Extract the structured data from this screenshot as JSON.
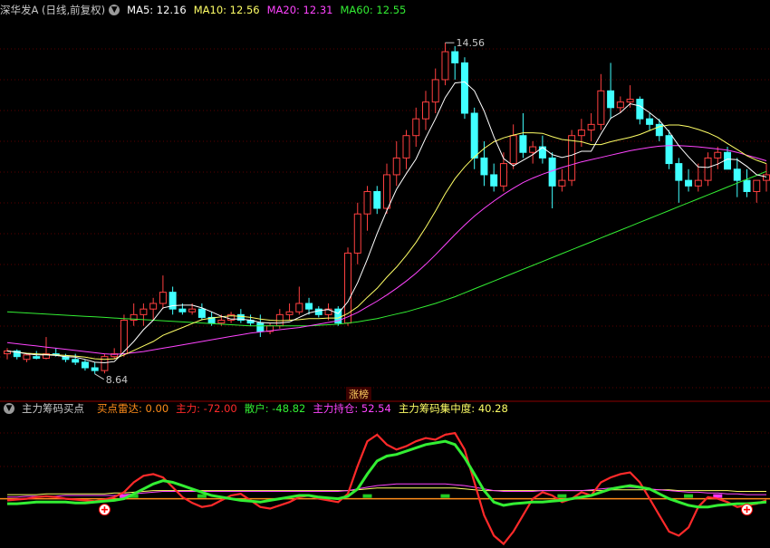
{
  "top": {
    "title": "深华发A (日线,前复权)",
    "ma": [
      {
        "label": "MA5: 12.16",
        "color": "#ffffff"
      },
      {
        "label": "MA10: 12.56",
        "color": "#ffff66"
      },
      {
        "label": "MA20: 12.31",
        "color": "#ff44ff"
      },
      {
        "label": "MA60: 12.55",
        "color": "#33ee33"
      }
    ],
    "high_label": "14.56",
    "low_label": "8.64",
    "limit_up_label": "涨榜"
  },
  "indicator": {
    "name": "主力筹码买点",
    "items": [
      {
        "label": "买点雷达: 0.00",
        "color": "#ff8c1a"
      },
      {
        "label": "主力: -72.00",
        "color": "#ff2a2a"
      },
      {
        "label": "散户: -48.82",
        "color": "#33ee33"
      },
      {
        "label": "主力持仓: 52.54",
        "color": "#ff44ff"
      },
      {
        "label": "主力筹码集中度: 40.28",
        "color": "#ffff66"
      }
    ]
  },
  "chart_data": {
    "type": "candlestick",
    "ylim": [
      8.2,
      15.0
    ],
    "colors": {
      "up": "#ff4040",
      "down": "#40ffff",
      "ma5": "#ffffff",
      "ma10": "#ffff66",
      "ma20": "#ff44ff",
      "ma60": "#33ee33"
    },
    "candles": [
      [
        9.0,
        9.1,
        8.9,
        9.05
      ],
      [
        9.05,
        9.08,
        8.9,
        8.95
      ],
      [
        8.9,
        9.0,
        8.85,
        8.98
      ],
      [
        8.95,
        9.05,
        8.9,
        8.92
      ],
      [
        8.92,
        9.3,
        8.9,
        9.0
      ],
      [
        9.0,
        9.1,
        8.95,
        8.98
      ],
      [
        8.95,
        9.0,
        8.85,
        8.9
      ],
      [
        8.9,
        9.0,
        8.8,
        8.85
      ],
      [
        8.85,
        8.9,
        8.7,
        8.75
      ],
      [
        8.75,
        8.85,
        8.64,
        8.7
      ],
      [
        8.7,
        9.0,
        8.65,
        8.95
      ],
      [
        8.95,
        9.1,
        8.9,
        9.0
      ],
      [
        9.0,
        9.7,
        8.95,
        9.6
      ],
      [
        9.6,
        9.9,
        9.5,
        9.7
      ],
      [
        9.7,
        9.9,
        9.5,
        9.8
      ],
      [
        9.8,
        10.0,
        9.6,
        9.9
      ],
      [
        9.9,
        10.4,
        9.8,
        10.1
      ],
      [
        10.1,
        10.2,
        9.7,
        9.8
      ],
      [
        9.8,
        9.9,
        9.7,
        9.75
      ],
      [
        9.75,
        9.9,
        9.7,
        9.8
      ],
      [
        9.8,
        9.9,
        9.6,
        9.65
      ],
      [
        9.65,
        9.75,
        9.5,
        9.55
      ],
      [
        9.55,
        9.7,
        9.5,
        9.6
      ],
      [
        9.6,
        9.75,
        9.55,
        9.7
      ],
      [
        9.7,
        9.8,
        9.55,
        9.6
      ],
      [
        9.6,
        9.7,
        9.5,
        9.55
      ],
      [
        9.55,
        9.7,
        9.3,
        9.4
      ],
      [
        9.4,
        9.55,
        9.35,
        9.5
      ],
      [
        9.5,
        9.8,
        9.45,
        9.7
      ],
      [
        9.7,
        9.9,
        9.6,
        9.75
      ],
      [
        9.75,
        10.2,
        9.7,
        9.9
      ],
      [
        9.9,
        10.0,
        9.7,
        9.8
      ],
      [
        9.8,
        9.85,
        9.65,
        9.7
      ],
      [
        9.7,
        9.9,
        9.6,
        9.8
      ],
      [
        9.8,
        9.85,
        9.5,
        9.55
      ],
      [
        9.55,
        10.9,
        9.5,
        10.8
      ],
      [
        10.8,
        11.7,
        10.6,
        11.5
      ],
      [
        11.5,
        12.0,
        11.2,
        11.9
      ],
      [
        11.9,
        12.0,
        11.5,
        11.6
      ],
      [
        11.6,
        12.4,
        11.5,
        12.2
      ],
      [
        12.2,
        12.8,
        12.0,
        12.5
      ],
      [
        12.5,
        13.0,
        12.3,
        12.9
      ],
      [
        12.9,
        13.4,
        12.7,
        13.2
      ],
      [
        13.2,
        13.7,
        13.0,
        13.5
      ],
      [
        13.5,
        14.1,
        13.3,
        13.9
      ],
      [
        13.9,
        14.56,
        13.8,
        14.4
      ],
      [
        14.4,
        14.5,
        13.9,
        14.2
      ],
      [
        14.2,
        14.3,
        13.2,
        13.3
      ],
      [
        13.3,
        13.4,
        12.3,
        12.5
      ],
      [
        12.5,
        12.8,
        12.0,
        12.2
      ],
      [
        12.2,
        12.4,
        11.9,
        12.0
      ],
      [
        12.0,
        12.6,
        11.9,
        12.4
      ],
      [
        12.4,
        13.1,
        12.3,
        12.9
      ],
      [
        12.9,
        13.3,
        12.5,
        12.6
      ],
      [
        12.6,
        12.8,
        12.4,
        12.7
      ],
      [
        12.7,
        12.9,
        12.4,
        12.5
      ],
      [
        12.5,
        12.6,
        11.6,
        12.0
      ],
      [
        12.0,
        12.3,
        11.9,
        12.1
      ],
      [
        12.1,
        13.0,
        12.0,
        12.9
      ],
      [
        12.9,
        13.2,
        12.7,
        13.0
      ],
      [
        13.0,
        13.3,
        12.8,
        13.1
      ],
      [
        13.1,
        14.0,
        13.0,
        13.7
      ],
      [
        13.7,
        14.2,
        13.2,
        13.4
      ],
      [
        13.4,
        13.6,
        13.3,
        13.5
      ],
      [
        13.5,
        13.8,
        13.4,
        13.55
      ],
      [
        13.55,
        13.6,
        13.1,
        13.2
      ],
      [
        13.2,
        13.3,
        13.0,
        13.1
      ],
      [
        13.1,
        13.2,
        12.8,
        12.9
      ],
      [
        12.9,
        13.0,
        12.3,
        12.4
      ],
      [
        12.4,
        12.5,
        11.7,
        12.1
      ],
      [
        12.1,
        12.3,
        11.9,
        12.0
      ],
      [
        12.0,
        12.4,
        11.9,
        12.1
      ],
      [
        12.1,
        12.6,
        12.0,
        12.5
      ],
      [
        12.5,
        12.7,
        12.3,
        12.6
      ],
      [
        12.6,
        12.7,
        12.3,
        12.3
      ],
      [
        12.3,
        12.5,
        11.8,
        12.1
      ],
      [
        12.1,
        12.3,
        11.8,
        11.9
      ],
      [
        11.9,
        12.1,
        11.7,
        12.1
      ],
      [
        12.1,
        12.4,
        11.9,
        12.2
      ]
    ],
    "ma5": [
      9.05,
      9.03,
      9.0,
      8.98,
      8.98,
      8.97,
      8.95,
      8.94,
      8.9,
      8.85,
      8.84,
      8.86,
      9.04,
      9.22,
      9.43,
      9.6,
      9.82,
      9.86,
      9.87,
      9.87,
      9.82,
      9.75,
      9.67,
      9.62,
      9.62,
      9.6,
      9.56,
      9.55,
      9.55,
      9.57,
      9.65,
      9.73,
      9.77,
      9.79,
      9.72,
      9.93,
      10.27,
      10.69,
      11.15,
      11.56,
      11.94,
      12.22,
      12.48,
      12.86,
      13.2,
      13.58,
      13.84,
      13.86,
      13.7,
      13.34,
      12.88,
      12.49,
      12.36,
      12.46,
      12.56,
      12.69,
      12.56,
      12.51,
      12.55,
      12.62,
      12.62,
      12.93,
      13.21,
      13.31,
      13.47,
      13.43,
      13.31,
      13.17,
      12.97,
      12.72,
      12.52,
      12.34,
      12.33,
      12.39,
      12.48,
      12.47,
      12.35,
      12.2,
      12.16
    ],
    "ma10": [
      9.05,
      9.03,
      9.01,
      9.0,
      8.99,
      8.98,
      8.97,
      8.96,
      8.94,
      8.91,
      8.9,
      8.91,
      8.98,
      9.06,
      9.14,
      9.22,
      9.33,
      9.4,
      9.47,
      9.54,
      9.61,
      9.64,
      9.66,
      9.68,
      9.67,
      9.65,
      9.62,
      9.6,
      9.59,
      9.6,
      9.61,
      9.63,
      9.63,
      9.64,
      9.64,
      9.72,
      9.84,
      10.01,
      10.17,
      10.37,
      10.55,
      10.76,
      10.99,
      11.26,
      11.55,
      11.86,
      12.13,
      12.34,
      12.52,
      12.67,
      12.79,
      12.86,
      12.91,
      12.95,
      12.95,
      12.94,
      12.88,
      12.83,
      12.81,
      12.79,
      12.74,
      12.74,
      12.79,
      12.83,
      12.87,
      12.92,
      12.99,
      13.06,
      13.09,
      13.09,
      13.06,
      13.01,
      12.95,
      12.87,
      12.76,
      12.65,
      12.54,
      12.46,
      12.4
    ],
    "ma20": [
      9.2,
      9.18,
      9.16,
      9.14,
      9.12,
      9.1,
      9.08,
      9.06,
      9.04,
      9.02,
      9.0,
      8.99,
      9.0,
      9.02,
      9.04,
      9.07,
      9.1,
      9.13,
      9.16,
      9.19,
      9.22,
      9.25,
      9.28,
      9.31,
      9.34,
      9.37,
      9.39,
      9.41,
      9.43,
      9.45,
      9.47,
      9.5,
      9.53,
      9.56,
      9.59,
      9.66,
      9.74,
      9.84,
      9.94,
      10.05,
      10.17,
      10.3,
      10.44,
      10.6,
      10.77,
      10.95,
      11.13,
      11.3,
      11.46,
      11.6,
      11.73,
      11.85,
      11.96,
      12.06,
      12.14,
      12.21,
      12.27,
      12.33,
      12.38,
      12.43,
      12.47,
      12.51,
      12.55,
      12.59,
      12.63,
      12.66,
      12.69,
      12.71,
      12.72,
      12.72,
      12.71,
      12.7,
      12.68,
      12.66,
      12.64,
      12.6,
      12.55,
      12.5,
      12.45
    ],
    "ma60": [
      9.75,
      9.74,
      9.73,
      9.72,
      9.71,
      9.7,
      9.69,
      9.68,
      9.67,
      9.66,
      9.65,
      9.64,
      9.63,
      9.62,
      9.61,
      9.6,
      9.59,
      9.58,
      9.57,
      9.56,
      9.55,
      9.54,
      9.53,
      9.52,
      9.51,
      9.5,
      9.5,
      9.5,
      9.5,
      9.5,
      9.5,
      9.5,
      9.51,
      9.52,
      9.53,
      9.55,
      9.57,
      9.6,
      9.63,
      9.67,
      9.71,
      9.75,
      9.8,
      9.85,
      9.9,
      9.96,
      10.02,
      10.09,
      10.16,
      10.23,
      10.3,
      10.37,
      10.44,
      10.51,
      10.58,
      10.65,
      10.72,
      10.79,
      10.86,
      10.93,
      11.0,
      11.07,
      11.14,
      11.21,
      11.28,
      11.35,
      11.42,
      11.49,
      11.56,
      11.63,
      11.7,
      11.77,
      11.84,
      11.91,
      11.98,
      12.05,
      12.12,
      12.19,
      12.26
    ],
    "indicator": {
      "ylim": [
        -60,
        100
      ],
      "zhuli": [
        -2,
        -1,
        0,
        2,
        3,
        2,
        0,
        -1,
        -2,
        -3,
        -1,
        2,
        8,
        20,
        28,
        30,
        26,
        14,
        2,
        -5,
        -10,
        -8,
        -2,
        4,
        6,
        -2,
        -10,
        -12,
        -8,
        -4,
        2,
        4,
        0,
        -2,
        -4,
        6,
        40,
        70,
        78,
        66,
        60,
        64,
        70,
        74,
        72,
        78,
        80,
        60,
        20,
        -20,
        -45,
        -55,
        -40,
        -20,
        0,
        8,
        4,
        -4,
        0,
        8,
        4,
        20,
        26,
        30,
        32,
        20,
        0,
        -20,
        -40,
        -45,
        -35,
        -10,
        2,
        0,
        -4,
        -10,
        -8,
        -6,
        -2
      ],
      "sanhu": [
        -6,
        -6,
        -5,
        -4,
        -4,
        -4,
        -4,
        -5,
        -5,
        -4,
        -3,
        -2,
        0,
        6,
        12,
        18,
        22,
        20,
        16,
        12,
        8,
        4,
        2,
        0,
        -2,
        -3,
        -4,
        -2,
        0,
        2,
        4,
        4,
        2,
        1,
        0,
        3,
        12,
        30,
        46,
        52,
        54,
        58,
        62,
        66,
        68,
        70,
        66,
        50,
        30,
        10,
        -4,
        -8,
        -6,
        -5,
        -4,
        -4,
        -3,
        -2,
        0,
        2,
        4,
        8,
        12,
        14,
        16,
        14,
        12,
        6,
        0,
        -4,
        -8,
        -10,
        -10,
        -8,
        -7,
        -6,
        -6,
        -5,
        -4
      ],
      "chicang": [
        2,
        2,
        3,
        3,
        3,
        3,
        4,
        4,
        4,
        4,
        4,
        4,
        5,
        6,
        7,
        8,
        9,
        9,
        9,
        9,
        9,
        9,
        9,
        9,
        9,
        9,
        9,
        9,
        9,
        9,
        9,
        9,
        9,
        9,
        9,
        10,
        12,
        14,
        16,
        17,
        18,
        18,
        18,
        18,
        18,
        18,
        17,
        16,
        14,
        12,
        10,
        9,
        9,
        9,
        9,
        10,
        10,
        10,
        10,
        10,
        11,
        12,
        13,
        14,
        14,
        13,
        12,
        11,
        10,
        9,
        8,
        8,
        7,
        7,
        6,
        6,
        5,
        5,
        5
      ],
      "jizhong": [
        5,
        5,
        5,
        5,
        6,
        6,
        6,
        6,
        6,
        6,
        6,
        7,
        7,
        8,
        9,
        10,
        10,
        10,
        10,
        10,
        10,
        10,
        10,
        10,
        10,
        10,
        10,
        10,
        10,
        10,
        10,
        10,
        10,
        10,
        10,
        10,
        11,
        12,
        13,
        13,
        13,
        13,
        13,
        13,
        13,
        13,
        13,
        12,
        11,
        10,
        10,
        10,
        10,
        10,
        10,
        10,
        10,
        10,
        10,
        10,
        10,
        10,
        11,
        11,
        11,
        11,
        11,
        11,
        11,
        10,
        10,
        10,
        10,
        10,
        10,
        9,
        9,
        9,
        9
      ],
      "buy_points": [
        10,
        76
      ]
    }
  }
}
